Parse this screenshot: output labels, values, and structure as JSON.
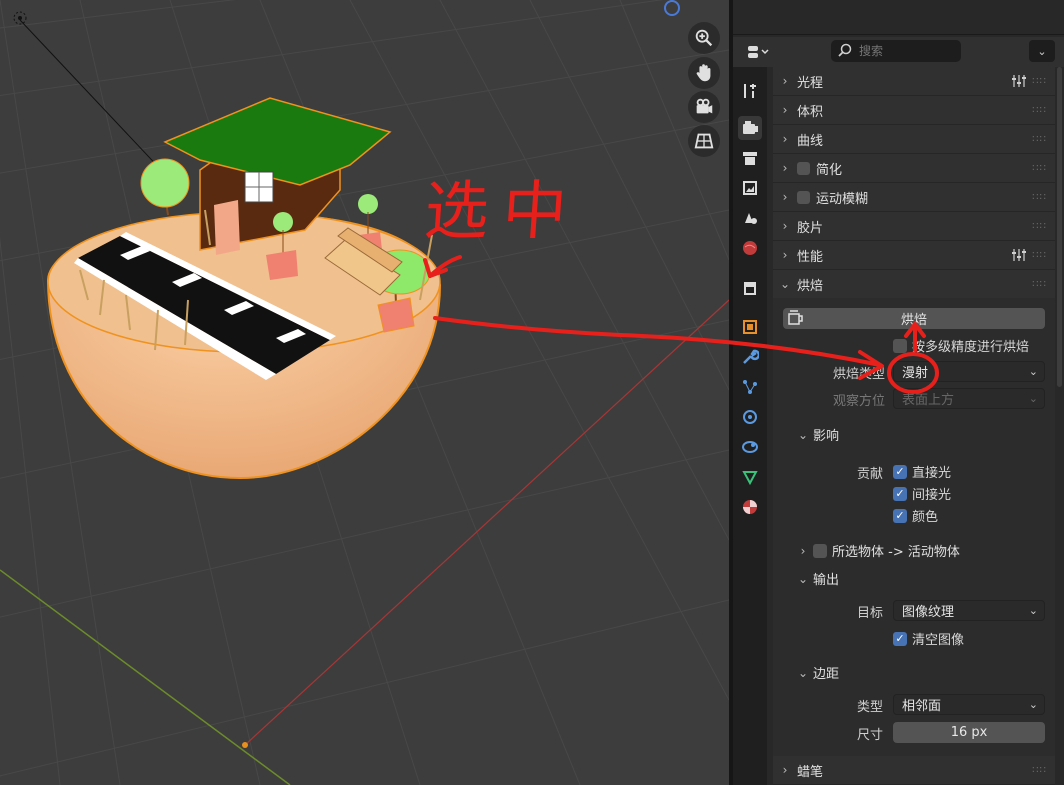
{
  "search": {
    "placeholder": "搜索"
  },
  "panels": {
    "light_paths": "光程",
    "volumes": "体积",
    "curves": "曲线",
    "simplify": "简化",
    "motion_blur": "运动模糊",
    "film": "胶片",
    "performance": "性能",
    "bake": "烘焙",
    "grease_pencil": "蜡笔"
  },
  "bake": {
    "bake_button": "烘焙",
    "multires_label": "按多级精度进行烘焙",
    "bake_type_label": "烘焙类型",
    "bake_type_value": "漫射",
    "view_from_label": "观察方位",
    "view_from_value": "表面上方",
    "influence": {
      "title": "影响",
      "contributions_label": "贡献",
      "direct": "直接光",
      "indirect": "间接光",
      "color": "颜色"
    },
    "selected_to_active": "所选物体 -> 活动物体",
    "output": {
      "title": "输出",
      "target_label": "目标",
      "target_value": "图像纹理",
      "clear_image": "清空图像"
    },
    "margin": {
      "title": "边距",
      "type_label": "类型",
      "type_value": "相邻面",
      "size_label": "尺寸",
      "size_value": "16 px"
    }
  },
  "annotation": {
    "text": "选中"
  },
  "colors": {
    "accent": "#4772b3",
    "annotation": "#e8201c",
    "selection_outline": "#f0921e"
  }
}
